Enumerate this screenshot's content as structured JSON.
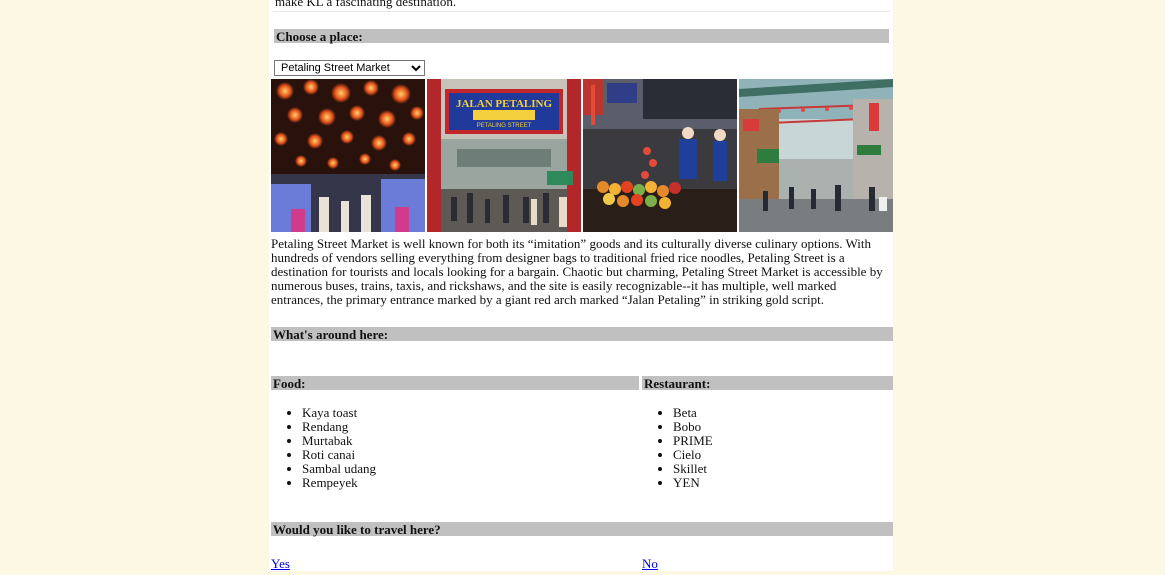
{
  "intro_tail": "make KL a fascinating destination.",
  "choose_heading": "Choose a place:",
  "place_select": {
    "selected": "Petaling Street Market"
  },
  "gallery": {
    "sign_text_1": "JALAN PETALING",
    "sign_text_2": "PETALING STREET"
  },
  "description": "Petaling Street Market is well known for both its “imitation” goods and its culturally diverse culinary options. With hundreds of vendors selling everything from designer bags to traditional fried rice noodles, Petaling Street is a destination for tourists and locals looking for a bargain. Chaotic but charming, Petaling Street Market is accessible by numerous buses, trains, taxis, and rickshaws, and the site is easily recognizable--it has multiple, well marked entrances, the primary entrance marked by a giant red arch marked “Jalan Petaling” in striking gold script.",
  "around_heading": "What's around here:",
  "food": {
    "heading": "Food:",
    "items": [
      "Kaya toast",
      "Rendang",
      "Murtabak",
      "Roti canai",
      "Sambal udang",
      "Rempeyek"
    ]
  },
  "restaurant": {
    "heading": "Restaurant:",
    "items": [
      "Beta",
      "Bobo",
      "PRIME",
      "Cielo",
      "Skillet",
      "YEN"
    ]
  },
  "travel": {
    "heading": "Would you like to travel here?",
    "yes": "Yes",
    "no": "No"
  },
  "colors": {
    "page_background": "#fdf8e3",
    "content_background": "#ffffff",
    "header_bar": "#c0c0c0",
    "link": "#0000ee"
  }
}
